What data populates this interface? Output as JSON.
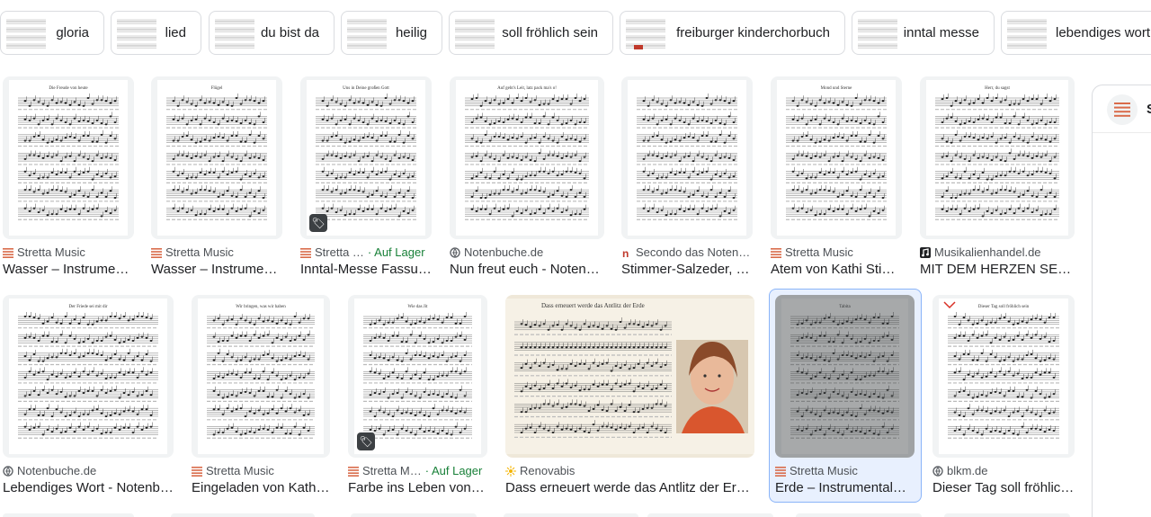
{
  "chips": [
    {
      "label": "gloria"
    },
    {
      "label": "lied"
    },
    {
      "label": "du bist da"
    },
    {
      "label": "heilig"
    },
    {
      "label": "soll fröhlich sein"
    },
    {
      "label": "freiburger kinderchorbuch"
    },
    {
      "label": "inntal messe"
    },
    {
      "label": "lebendiges wort"
    }
  ],
  "results": [
    {
      "source": "Stretta Music",
      "title": "Wasser – Instrumen…",
      "favicon": "stretta-icon",
      "heading": "Die Freude von heute",
      "in_stock": ""
    },
    {
      "source": "Stretta Music",
      "title": "Wasser – Instrumen…",
      "favicon": "stretta-icon",
      "heading": "Flügel",
      "in_stock": ""
    },
    {
      "source": "Stretta …",
      "title": "Inntal-Messe Fassu…",
      "favicon": "stretta-icon",
      "heading": "Uns in Deine großen Gott",
      "in_stock": "· Auf Lager"
    },
    {
      "source": "Notenbuche.de",
      "title": "Nun freut euch - Notenb…",
      "favicon": "notenbuche-icon",
      "heading": "Auf geht's Leit, latz pack ma's o!",
      "in_stock": ""
    },
    {
      "source": "Secondo das Noten…",
      "title": "Stimmer-Salzeder, …",
      "favicon": "secondo-icon",
      "heading": "",
      "in_stock": ""
    },
    {
      "source": "Stretta Music",
      "title": "Atem von Kathi Sti…",
      "favicon": "stretta-icon",
      "heading": "Mond und Sterne",
      "in_stock": ""
    },
    {
      "source": "Musikalienhandel.de",
      "title": "MIT DEM HERZEN SE…",
      "favicon": "musikalienhandel-icon",
      "heading": "Herr, du sagst",
      "in_stock": ""
    },
    {
      "source": "Notenbuche.de",
      "title": "Lebendiges Wort - Notenb…",
      "favicon": "notenbuche-icon",
      "heading": "Der Friede sei mit dir",
      "in_stock": ""
    },
    {
      "source": "Stretta Music",
      "title": "Eingeladen von Kathi…",
      "favicon": "stretta-icon",
      "heading": "Wir bringen, was wir haben",
      "in_stock": ""
    },
    {
      "source": "Stretta M…",
      "title": "Farbe ins Leben von …",
      "favicon": "stretta-icon",
      "heading": "Wie das Jit",
      "in_stock": "· Auf Lager"
    },
    {
      "source": "Renovabis",
      "title": "Dass erneuert werde das Antlitz der Erd…",
      "favicon": "renovabis-icon",
      "heading": "Dass erneuert werde das Antlitz der Erde",
      "in_stock": ""
    },
    {
      "source": "Stretta Music",
      "title": "Erde – Instrumental…",
      "favicon": "stretta-icon",
      "heading": "Tabita",
      "in_stock": ""
    },
    {
      "source": "blkm.de",
      "title": "Dieser Tag soll fröhlic…",
      "favicon": "blkm-icon",
      "heading": "Dieser Tag soll fröhlich sein",
      "in_stock": ""
    }
  ],
  "side_panel": {
    "title_initial": "S",
    "logo": "stretta-icon"
  },
  "colors": {
    "accent": "#1a73e8",
    "stock_green": "#188038",
    "stretta": "#d96b4a"
  }
}
